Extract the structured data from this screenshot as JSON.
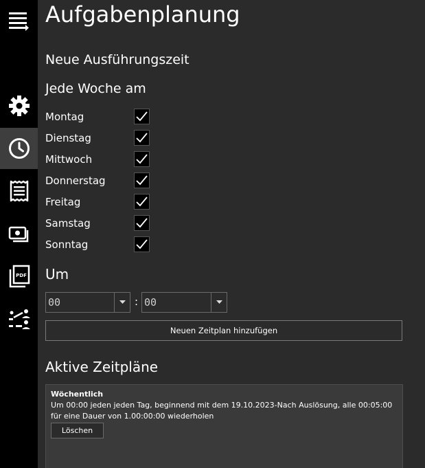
{
  "page": {
    "title": "Aufgabenplanung"
  },
  "sidebar": {
    "items": [
      {
        "icon": "hamburger-menu-icon",
        "active": false
      },
      {
        "icon": "gear-icon",
        "active": false
      },
      {
        "icon": "clock-icon",
        "active": true
      },
      {
        "icon": "receipt-icon",
        "active": false
      },
      {
        "icon": "money-icon",
        "active": false
      },
      {
        "icon": "pdf-icon",
        "active": false
      },
      {
        "icon": "workflow-icon",
        "active": false
      }
    ]
  },
  "new_time": {
    "heading": "Neue Ausführungszeit",
    "weekly_heading": "Jede Woche am",
    "days": [
      {
        "label": "Montag",
        "checked": true
      },
      {
        "label": "Dienstag",
        "checked": true
      },
      {
        "label": "Mittwoch",
        "checked": true
      },
      {
        "label": "Donnerstag",
        "checked": true
      },
      {
        "label": "Freitag",
        "checked": true
      },
      {
        "label": "Samstag",
        "checked": true
      },
      {
        "label": "Sonntag",
        "checked": true
      }
    ],
    "at_label": "Um",
    "hour": "00",
    "separator": ":",
    "minute": "00",
    "add_button": "Neuen Zeitplan hinzufügen"
  },
  "active": {
    "heading": "Aktive Zeitpläne",
    "schedules": [
      {
        "type": "Wöchentlich",
        "description": "Um 00:00 jeden jeden Tag, beginnend mit dem 19.10.2023-Nach Auslösung, alle 00:05:00 für eine Dauer von 1.00:00:00 wiederholen",
        "delete_button": "Löschen"
      }
    ]
  },
  "colors": {
    "background": "#2b2b2b",
    "sidebar": "#000000",
    "sidebar_active": "#3e3e3e",
    "panel": "#3a3a3a"
  }
}
